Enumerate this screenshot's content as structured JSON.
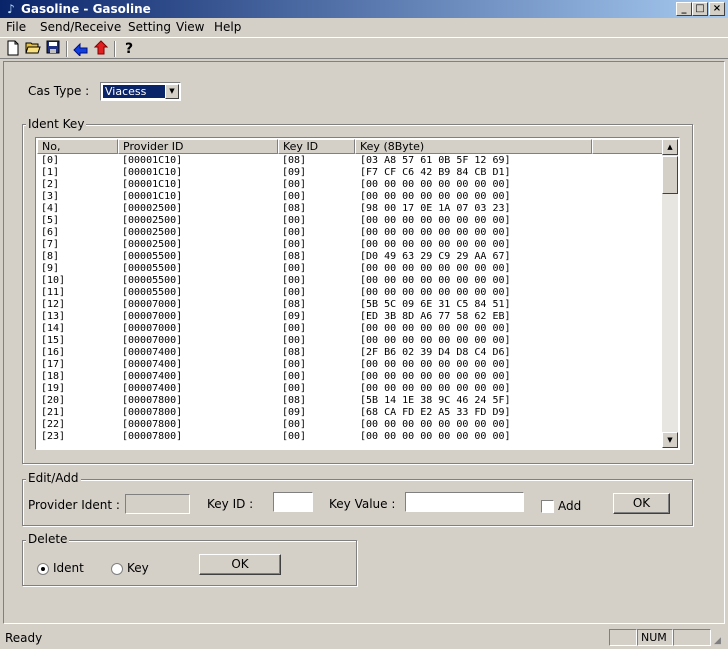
{
  "window": {
    "title": "Gasoline - Gasoline"
  },
  "menu": [
    "File",
    "Send/Receive",
    "Setting",
    "View",
    "Help"
  ],
  "toolbar": {
    "icons": [
      "new-file-icon",
      "open-folder-icon",
      "save-icon",
      "download-arrow-icon",
      "upload-arrow-icon",
      "help-icon"
    ]
  },
  "cas": {
    "label": "Cas Type :",
    "value": "Viacess"
  },
  "ident_group": {
    "title": "Ident Key"
  },
  "table": {
    "columns": [
      "No,",
      "Provider ID",
      "Key ID",
      "Key (8Byte)"
    ],
    "rows": [
      [
        "[0]",
        "[00001C10]",
        "[08]",
        "[03 A8 57 61 0B 5F 12 69]"
      ],
      [
        "[1]",
        "[00001C10]",
        "[09]",
        "[F7 CF C6 42 B9 84 CB D1]"
      ],
      [
        "[2]",
        "[00001C10]",
        "[00]",
        "[00 00 00 00 00 00 00 00]"
      ],
      [
        "[3]",
        "[00001C10]",
        "[00]",
        "[00 00 00 00 00 00 00 00]"
      ],
      [
        "[4]",
        "[00002500]",
        "[08]",
        "[98 00 17 0E 1A 07 03 23]"
      ],
      [
        "[5]",
        "[00002500]",
        "[00]",
        "[00 00 00 00 00 00 00 00]"
      ],
      [
        "[6]",
        "[00002500]",
        "[00]",
        "[00 00 00 00 00 00 00 00]"
      ],
      [
        "[7]",
        "[00002500]",
        "[00]",
        "[00 00 00 00 00 00 00 00]"
      ],
      [
        "[8]",
        "[00005500]",
        "[08]",
        "[D0 49 63 29 C9 29 AA 67]"
      ],
      [
        "[9]",
        "[00005500]",
        "[00]",
        "[00 00 00 00 00 00 00 00]"
      ],
      [
        "[10]",
        "[00005500]",
        "[00]",
        "[00 00 00 00 00 00 00 00]"
      ],
      [
        "[11]",
        "[00005500]",
        "[00]",
        "[00 00 00 00 00 00 00 00]"
      ],
      [
        "[12]",
        "[00007000]",
        "[08]",
        "[5B 5C 09 6E 31 C5 84 51]"
      ],
      [
        "[13]",
        "[00007000]",
        "[09]",
        "[ED 3B 8D A6 77 58 62 EB]"
      ],
      [
        "[14]",
        "[00007000]",
        "[00]",
        "[00 00 00 00 00 00 00 00]"
      ],
      [
        "[15]",
        "[00007000]",
        "[00]",
        "[00 00 00 00 00 00 00 00]"
      ],
      [
        "[16]",
        "[00007400]",
        "[08]",
        "[2F B6 02 39 D4 D8 C4 D6]"
      ],
      [
        "[17]",
        "[00007400]",
        "[00]",
        "[00 00 00 00 00 00 00 00]"
      ],
      [
        "[18]",
        "[00007400]",
        "[00]",
        "[00 00 00 00 00 00 00 00]"
      ],
      [
        "[19]",
        "[00007400]",
        "[00]",
        "[00 00 00 00 00 00 00 00]"
      ],
      [
        "[20]",
        "[00007800]",
        "[08]",
        "[5B 14 1E 38 9C 46 24 5F]"
      ],
      [
        "[21]",
        "[00007800]",
        "[09]",
        "[68 CA FD E2 A5 33 FD D9]"
      ],
      [
        "[22]",
        "[00007800]",
        "[00]",
        "[00 00 00 00 00 00 00 00]"
      ],
      [
        "[23]",
        "[00007800]",
        "[00]",
        "[00 00 00 00 00 00 00 00]"
      ]
    ]
  },
  "edit": {
    "title": "Edit/Add",
    "provider_label": "Provider Ident :",
    "keyid_label": "Key ID :",
    "keyvalue_label": "Key Value :",
    "add_label": "Add",
    "ok_label": "OK"
  },
  "delete": {
    "title": "Delete",
    "ident_label": "Ident",
    "key_label": "Key",
    "selected": "Ident",
    "ok_label": "OK"
  },
  "status": {
    "text": "Ready",
    "num": "NUM"
  }
}
